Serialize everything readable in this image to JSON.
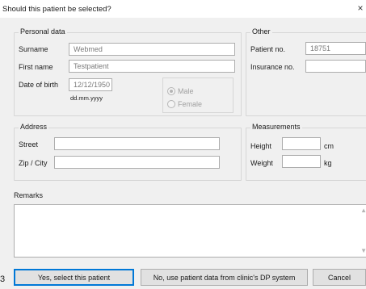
{
  "window": {
    "title": "Should this patient be selected?",
    "close_glyph": "×"
  },
  "personal": {
    "title": "Personal data",
    "surname_label": "Surname",
    "surname_value": "Webmed",
    "firstname_label": "First name",
    "firstname_value": "Testpatient",
    "dob_label": "Date of birth",
    "dob_value": "12/12/1950",
    "dob_hint": "dd.mm.yyyy",
    "gender_male": "Male",
    "gender_female": "Female",
    "gender_selected": "Male"
  },
  "other": {
    "title": "Other",
    "patient_no_label": "Patient no.",
    "patient_no_value": "18751",
    "insurance_no_label": "Insurance no.",
    "insurance_no_value": ""
  },
  "address": {
    "title": "Address",
    "street_label": "Street",
    "street_value": "",
    "zip_label": "Zip / City",
    "zip_value": ""
  },
  "measurements": {
    "title": "Measurements",
    "height_label": "Height",
    "height_value": "",
    "height_unit": "cm",
    "weight_label": "Weight",
    "weight_value": "",
    "weight_unit": "kg"
  },
  "remarks": {
    "label": "Remarks",
    "value": ""
  },
  "buttons": {
    "yes": "Yes, select this patient",
    "no": "No, use patient data from clinic's DP system",
    "cancel": "Cancel"
  },
  "edge_text": "3"
}
